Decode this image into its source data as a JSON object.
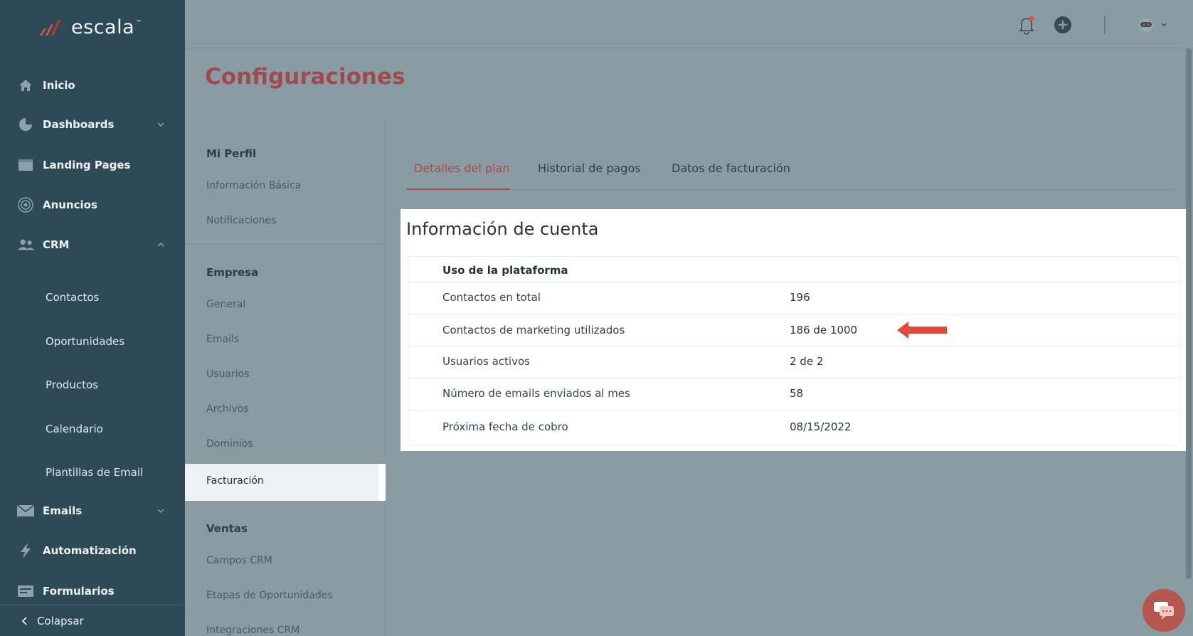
{
  "brand": {
    "name": "escala",
    "tm": "™",
    "accent": "#a04b4b",
    "sidebar_bg": "#2e4a57"
  },
  "sidebar": {
    "items": [
      {
        "label": "Inicio",
        "icon": "home-icon"
      },
      {
        "label": "Dashboards",
        "icon": "pie-chart-icon",
        "chevron": "down"
      },
      {
        "label": "Landing Pages",
        "icon": "browser-window-icon"
      },
      {
        "label": "Anuncios",
        "icon": "target-icon"
      },
      {
        "label": "CRM",
        "icon": "users-icon",
        "chevron": "up"
      },
      {
        "label": "Emails",
        "icon": "envelope-icon",
        "chevron": "down"
      },
      {
        "label": "Automatización",
        "icon": "lightning-icon"
      },
      {
        "label": "Formularios",
        "icon": "form-icon"
      }
    ],
    "crm_sub": [
      "Contactos",
      "Oportunidades",
      "Productos",
      "Calendario",
      "Plantillas de Email"
    ],
    "collapse_label": "Colapsar"
  },
  "topbar": {
    "icons": [
      "bell-icon",
      "plus-circle-icon",
      "avatar-icon"
    ]
  },
  "page": {
    "title": "Configuraciones"
  },
  "settings_nav": {
    "sections": [
      {
        "title": "Mi Perfil",
        "items": [
          "Información Básica",
          "Notificaciones"
        ]
      },
      {
        "title": "Empresa",
        "items": [
          "General",
          "Emails",
          "Usuarios",
          "Archivos",
          "Dominios",
          "Facturación"
        ]
      },
      {
        "title": "Ventas",
        "items": [
          "Campos CRM",
          "Etapas de Oportunidades",
          "Integraciones CRM"
        ]
      }
    ],
    "active": "Facturación"
  },
  "tabs": [
    "Detalles del plan",
    "Historial de pagos",
    "Datos de facturación"
  ],
  "active_tab": "Detalles del plan",
  "card": {
    "title": "Información de cuenta",
    "header": "Uso de la plataforma",
    "rows": [
      {
        "key": "Contactos en total",
        "value": "196"
      },
      {
        "key": "Contactos de marketing utilizados",
        "value": "186 de 1000"
      },
      {
        "key": "Usuarios activos",
        "value": "2 de 2"
      },
      {
        "key": "Número de emails enviados al mes",
        "value": "58"
      },
      {
        "key": "Próxima fecha de cobro",
        "value": "08/15/2022"
      }
    ]
  },
  "annotation": {
    "arrow_color": "#e14a38"
  }
}
